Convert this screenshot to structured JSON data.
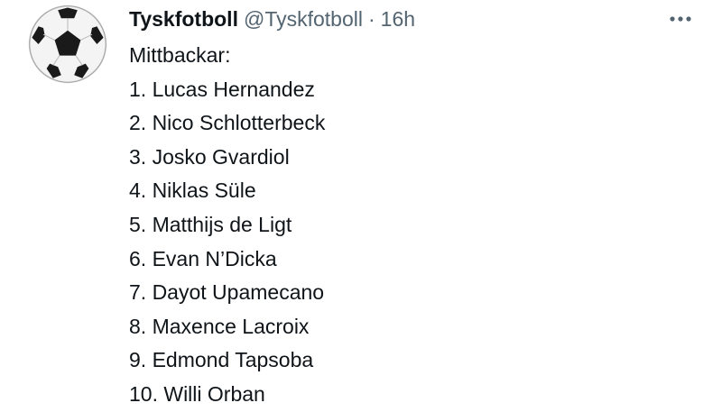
{
  "tweet": {
    "author": {
      "display_name": "Tyskfotboll",
      "handle": "@Tyskfotboll",
      "avatar_icon": "soccer-ball-icon"
    },
    "separator": "·",
    "time": "16h",
    "more_icon": "more-options-icon",
    "intro": "Mittbackar:",
    "list": [
      "1. Lucas Hernandez",
      "2. Nico Schlotterbeck",
      "3. Josko Gvardiol",
      "4. Niklas Süle",
      "5. Matthijs de Ligt",
      "6. Evan N’Dicka",
      "7. Dayot Upamecano",
      "8. Maxence Lacroix",
      "9. Edmond Tapsoba",
      "10. Willi Orban"
    ]
  },
  "colors": {
    "text_primary": "#0f1419",
    "text_secondary": "#536471",
    "background": "#ffffff"
  }
}
